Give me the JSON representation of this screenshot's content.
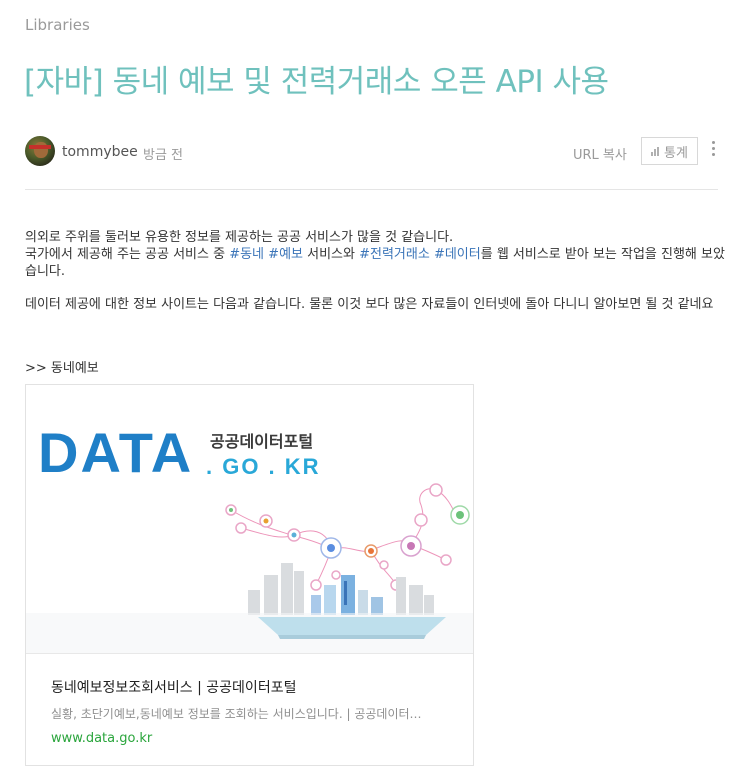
{
  "header": {
    "category": "Libraries",
    "title": "[자바] 동네 예보 및 전력거래소 오픈 API 사용"
  },
  "author": {
    "name": "tommybee",
    "time": "방금 전"
  },
  "actions": {
    "url_copy": "URL 복사",
    "stats": "통계"
  },
  "content": {
    "para1_line1": "의외로 주위를 둘러보 유용한 정보를 제공하는 공공 서비스가 많을 것 같습니다.",
    "para1_line2_a": "국가에서 제공해 주는 공공 서비스 중 ",
    "tag1": "#동네",
    "tag2": "#예보",
    "para1_line2_b": " 서비스와 ",
    "tag3": "#전력거래소",
    "tag4": "#데이터",
    "para1_line2_c": "를 웹 서비스로 받아 보는 작업을 진행해 보았습니다.",
    "para2": "데이터 제공에 대한 정보 사이트는 다음과 같습니다. 물론 이것 보다 많은 자료들이 인터넷에 돌아 다니니 알아보면 될 것 같네요",
    "section_label": ">> 동네예보"
  },
  "link_card": {
    "logo_main": "DATA",
    "logo_korean": "공공데이터포털",
    "logo_domain": ". GO . KR",
    "title": "동네예보정보조회서비스 | 공공데이터포털",
    "description": "실황, 초단기예보,동네예보 정보를 조회하는 서비스입니다. | 공공데이터…",
    "url": "www.data.go.kr"
  },
  "colors": {
    "title": "#6fc1bd",
    "tag": "#3a74b8",
    "link_url": "#2aa53c",
    "logo_blue": "#1f7fc7",
    "logo_cyan": "#29a8d8"
  }
}
